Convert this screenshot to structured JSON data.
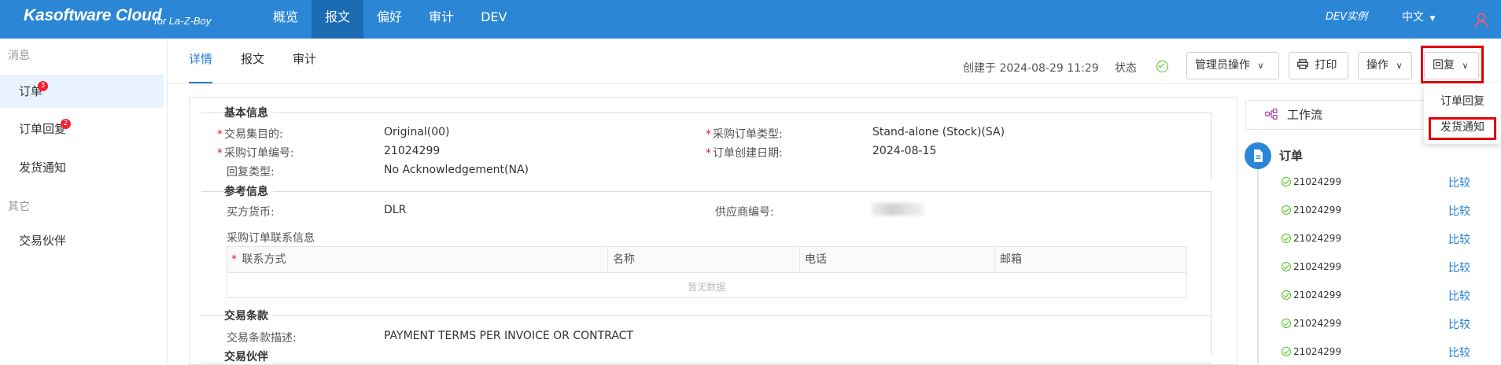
{
  "app": {
    "title": "Kasoftware Cloud",
    "subtitle": "for La-Z-Boy"
  },
  "nav": {
    "items": [
      "概览",
      "报文",
      "偏好",
      "审计",
      "DEV"
    ],
    "active_index": 1,
    "instance": "DEV实例",
    "language": "中文",
    "user_icon": "user-icon"
  },
  "sidebar": {
    "group_messages": "消息",
    "items": [
      {
        "label": "订单",
        "badge": "3"
      },
      {
        "label": "订单回复",
        "badge": "2"
      },
      {
        "label": "发货通知",
        "badge": ""
      }
    ],
    "group_other": "其它",
    "other_items": [
      {
        "label": "交易伙伴"
      }
    ]
  },
  "tabs": [
    "详情",
    "报文",
    "审计"
  ],
  "header": {
    "created": "创建于 2024-08-29 11:29",
    "status_label": "状态",
    "admin_btn": "管理员操作",
    "print_btn": "打印",
    "ops_btn": "操作",
    "reply_btn": "回复"
  },
  "dropdown": {
    "items": [
      "订单回复",
      "发货通知"
    ]
  },
  "basic_info": {
    "title": "基本信息",
    "fields": [
      {
        "label": "交易集目的:",
        "value": "Original(00)",
        "required": true
      },
      {
        "label": "采购订单编号:",
        "value": "21024299",
        "required": true
      },
      {
        "label": "回复类型:",
        "value": "No Acknowledgement(NA)",
        "required": false
      },
      {
        "label": "采购订单类型:",
        "value": "Stand-alone (Stock)(SA)",
        "required": true
      },
      {
        "label": "订单创建日期:",
        "value": "2024-08-15",
        "required": true
      }
    ]
  },
  "ref_info": {
    "title": "参考信息",
    "currency_label": "买方货币:",
    "currency_value": "DLR",
    "supplier_label": "供应商编号:",
    "contact_title": "采购订单联系信息",
    "columns": [
      "联系方式",
      "名称",
      "电话",
      "邮箱"
    ],
    "empty_text": "暂无数据"
  },
  "terms": {
    "title": "交易条款",
    "desc_label": "交易条款描述:",
    "desc_value": "PAYMENT TERMS PER INVOICE OR CONTRACT"
  },
  "partner": {
    "title": "交易伙伴"
  },
  "workflow": {
    "title": "工作流",
    "node": "订单",
    "entries": [
      {
        "id": "21024299",
        "action": "比较"
      },
      {
        "id": "21024299",
        "action": "比较"
      },
      {
        "id": "21024299",
        "action": "比较"
      },
      {
        "id": "21024299",
        "action": "比较"
      },
      {
        "id": "21024299",
        "action": "比较"
      },
      {
        "id": "21024299",
        "action": "比较"
      },
      {
        "id": "21024299",
        "action": "比较"
      }
    ]
  },
  "colors": {
    "primary": "#2b86d6",
    "highlight": "#e00000",
    "success": "#52c41a"
  }
}
